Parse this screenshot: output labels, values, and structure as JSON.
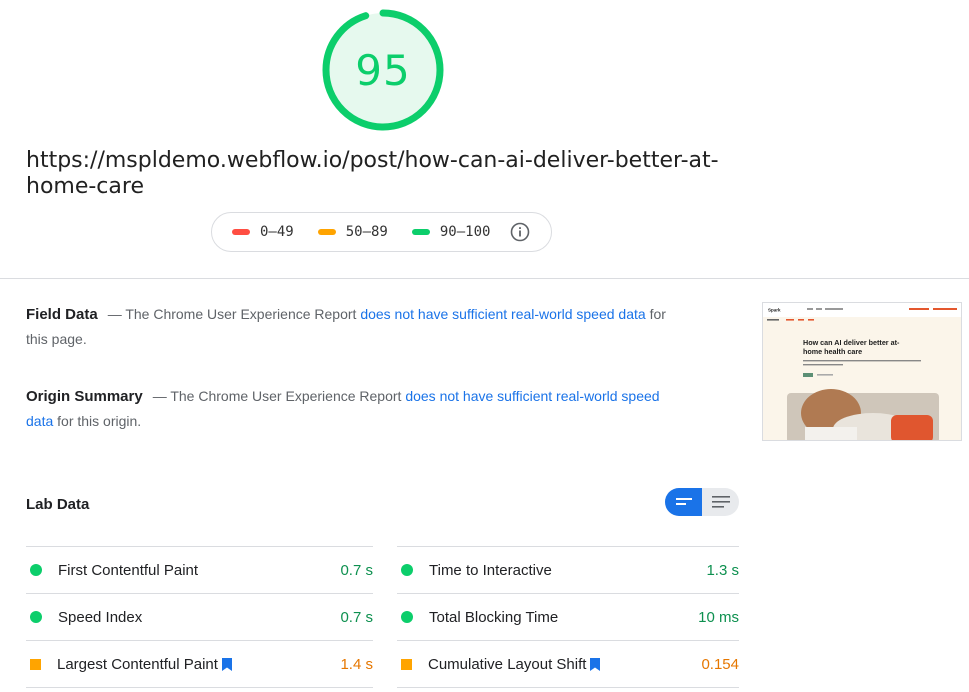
{
  "score": {
    "value": "95",
    "fraction": 0.95,
    "color": "#0cce6b",
    "ring_bg": "#e6f9ee"
  },
  "url": "https://mspldemo.webflow.io/post/how-can-ai-deliver-better-at-home-care",
  "legend": [
    {
      "label": "0–49",
      "color": "#ff4e42"
    },
    {
      "label": "50–89",
      "color": "#ffa400"
    },
    {
      "label": "90–100",
      "color": "#0cce6b"
    }
  ],
  "field_data": {
    "heading": "Field Data",
    "prefix": "— The Chrome User Experience Report ",
    "link": "does not have sufficient real-world speed data",
    "suffix": " for this page."
  },
  "origin_summary": {
    "heading": "Origin Summary",
    "prefix": "— The Chrome User Experience Report ",
    "link": "does not have sufficient real-world speed data",
    "suffix": " for this origin."
  },
  "thumbnail": {
    "logo": "Spark",
    "headline": "How can AI deliver better at-home health care"
  },
  "lab_data": {
    "title": "Lab Data",
    "left": [
      {
        "name": "First Contentful Paint",
        "value": "0.7 s",
        "status": "good"
      },
      {
        "name": "Speed Index",
        "value": "0.7 s",
        "status": "good"
      },
      {
        "name": "Largest Contentful Paint",
        "value": "1.4 s",
        "status": "avg",
        "bookmark": true
      }
    ],
    "right": [
      {
        "name": "Time to Interactive",
        "value": "1.3 s",
        "status": "good"
      },
      {
        "name": "Total Blocking Time",
        "value": "10 ms",
        "status": "good"
      },
      {
        "name": "Cumulative Layout Shift",
        "value": "0.154",
        "status": "avg",
        "bookmark": true
      }
    ]
  }
}
